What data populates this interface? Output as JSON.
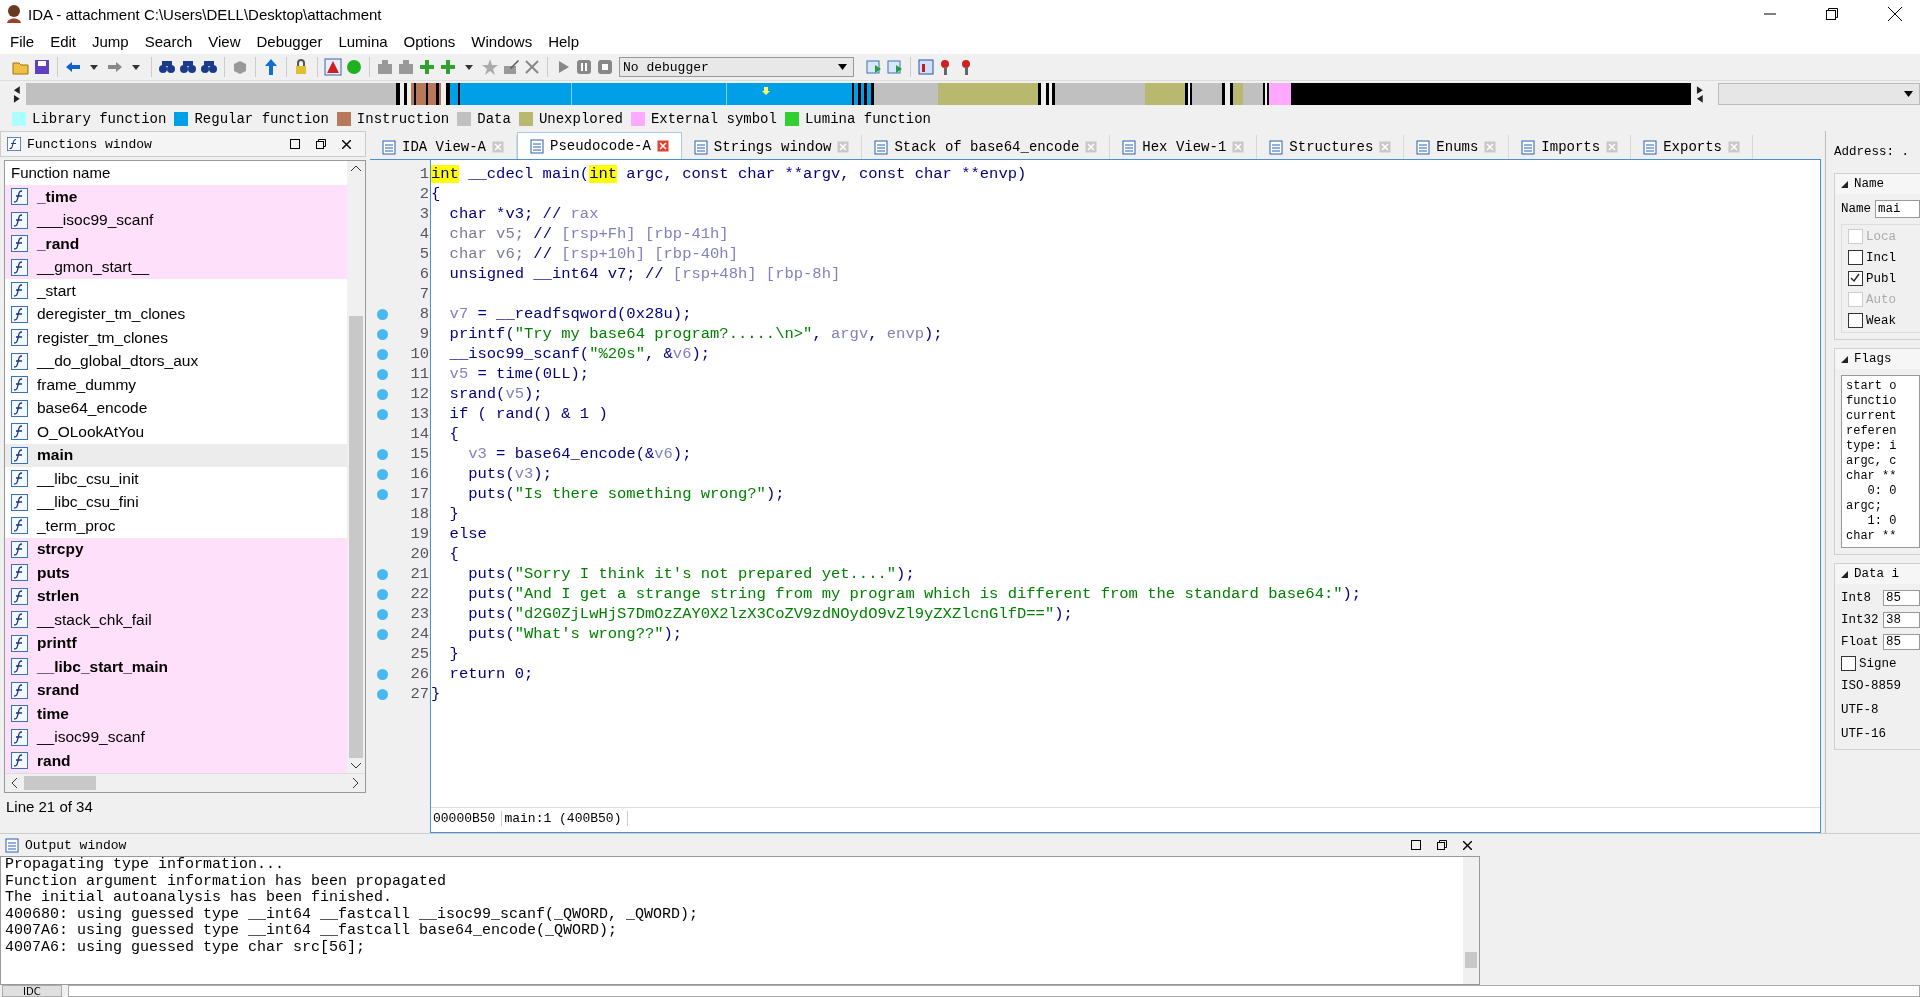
{
  "window": {
    "title": "IDA - attachment C:\\Users\\DELL\\Desktop\\attachment"
  },
  "menu": [
    "File",
    "Edit",
    "Jump",
    "Search",
    "View",
    "Debugger",
    "Lumina",
    "Options",
    "Windows",
    "Help"
  ],
  "toolbar": {
    "debugger_select": "No debugger"
  },
  "legend": [
    {
      "label": "Library function",
      "color": "#aaffff"
    },
    {
      "label": "Regular function",
      "color": "#00a0e8"
    },
    {
      "label": "Instruction",
      "color": "#b8785a"
    },
    {
      "label": "Data",
      "color": "#c0c0c0"
    },
    {
      "label": "Unexplored",
      "color": "#b8b870"
    },
    {
      "label": "External symbol",
      "color": "#ffa8ff"
    },
    {
      "label": "Lumina function",
      "color": "#30d030"
    }
  ],
  "functions_window": {
    "title": "Functions window",
    "column": "Function name",
    "status": "Line 21 of 34",
    "rows": [
      {
        "name": "_time",
        "bold": true,
        "external": true,
        "selected": false
      },
      {
        "name": "___isoc99_scanf",
        "bold": false,
        "external": true,
        "selected": false
      },
      {
        "name": "_rand",
        "bold": true,
        "external": true,
        "selected": false
      },
      {
        "name": "__gmon_start__",
        "bold": false,
        "external": true,
        "selected": false
      },
      {
        "name": "_start",
        "bold": false,
        "external": false,
        "selected": false
      },
      {
        "name": "deregister_tm_clones",
        "bold": false,
        "external": false,
        "selected": false
      },
      {
        "name": "register_tm_clones",
        "bold": false,
        "external": false,
        "selected": false
      },
      {
        "name": "__do_global_dtors_aux",
        "bold": false,
        "external": false,
        "selected": false
      },
      {
        "name": "frame_dummy",
        "bold": false,
        "external": false,
        "selected": false
      },
      {
        "name": "base64_encode",
        "bold": false,
        "external": false,
        "selected": false
      },
      {
        "name": "O_OLookAtYou",
        "bold": false,
        "external": false,
        "selected": false
      },
      {
        "name": "main",
        "bold": true,
        "external": false,
        "selected": true
      },
      {
        "name": "__libc_csu_init",
        "bold": false,
        "external": false,
        "selected": false
      },
      {
        "name": "__libc_csu_fini",
        "bold": false,
        "external": false,
        "selected": false
      },
      {
        "name": "_term_proc",
        "bold": false,
        "external": false,
        "selected": false
      },
      {
        "name": "strcpy",
        "bold": true,
        "external": true,
        "selected": false
      },
      {
        "name": "puts",
        "bold": true,
        "external": true,
        "selected": false
      },
      {
        "name": "strlen",
        "bold": true,
        "external": true,
        "selected": false
      },
      {
        "name": "__stack_chk_fail",
        "bold": false,
        "external": true,
        "selected": false
      },
      {
        "name": "printf",
        "bold": true,
        "external": true,
        "selected": false
      },
      {
        "name": "__libc_start_main",
        "bold": true,
        "external": true,
        "selected": false
      },
      {
        "name": "srand",
        "bold": true,
        "external": true,
        "selected": false
      },
      {
        "name": "time",
        "bold": true,
        "external": true,
        "selected": false
      },
      {
        "name": "__isoc99_scanf",
        "bold": false,
        "external": true,
        "selected": false
      },
      {
        "name": "rand",
        "bold": true,
        "external": true,
        "selected": false
      }
    ]
  },
  "tabs": [
    {
      "label": "IDA View-A",
      "selected": false
    },
    {
      "label": "Pseudocode-A",
      "selected": true
    },
    {
      "label": "Strings window",
      "selected": false
    },
    {
      "label": "Stack of base64_encode",
      "selected": false
    },
    {
      "label": "Hex View-1",
      "selected": false
    },
    {
      "label": "Structures",
      "selected": false
    },
    {
      "label": "Enums",
      "selected": false
    },
    {
      "label": "Imports",
      "selected": false
    },
    {
      "label": "Exports",
      "selected": false
    }
  ],
  "pseudocode": {
    "lines": [
      {
        "num": "1",
        "breakpoint": false,
        "tokens": [
          {
            "text": "int",
            "kind": "hl"
          },
          {
            "text": " __cdecl main(",
            "kind": "plain"
          },
          {
            "text": "int",
            "kind": "hl"
          },
          {
            "text": " argc, const char **argv, const char **envp)",
            "kind": "plain"
          }
        ]
      },
      {
        "num": "2",
        "breakpoint": false,
        "tokens": [
          {
            "text": "{",
            "kind": "plain"
          }
        ]
      },
      {
        "num": "3",
        "breakpoint": false,
        "tokens": [
          {
            "text": "  char *v3; // ",
            "kind": "plain"
          },
          {
            "text": "rax",
            "kind": "var"
          }
        ]
      },
      {
        "num": "4",
        "breakpoint": false,
        "tokens": [
          {
            "text": "  char v5; ",
            "kind": "dim"
          },
          {
            "text": "// ",
            "kind": "plain"
          },
          {
            "text": "[rsp+Fh] [rbp-41h]",
            "kind": "var"
          }
        ]
      },
      {
        "num": "5",
        "breakpoint": false,
        "tokens": [
          {
            "text": "  char v6; ",
            "kind": "dim"
          },
          {
            "text": "// ",
            "kind": "plain"
          },
          {
            "text": "[rsp+10h] [rbp-40h]",
            "kind": "var"
          }
        ]
      },
      {
        "num": "6",
        "breakpoint": false,
        "tokens": [
          {
            "text": "  unsigned __int64 v7; // ",
            "kind": "plain"
          },
          {
            "text": "[rsp+48h] [rbp-8h]",
            "kind": "var"
          }
        ]
      },
      {
        "num": "7",
        "breakpoint": false
      },
      {
        "num": "8",
        "breakpoint": true,
        "tokens": [
          {
            "text": "  v7",
            "kind": "var"
          },
          {
            "text": " = __readfsqword(0x28u);",
            "kind": "plain"
          }
        ]
      },
      {
        "num": "9",
        "breakpoint": true,
        "tokens": [
          {
            "text": "  printf(",
            "kind": "plain"
          },
          {
            "text": "\"Try my base64 program?.....\\n>\"",
            "kind": "str"
          },
          {
            "text": ", ",
            "kind": "plain"
          },
          {
            "text": "argv",
            "kind": "var"
          },
          {
            "text": ", ",
            "kind": "plain"
          },
          {
            "text": "envp",
            "kind": "var"
          },
          {
            "text": ");",
            "kind": "plain"
          }
        ]
      },
      {
        "num": "10",
        "breakpoint": true,
        "tokens": [
          {
            "text": "  __isoc99_scanf(",
            "kind": "plain"
          },
          {
            "text": "\"%20s\"",
            "kind": "str"
          },
          {
            "text": ", &",
            "kind": "plain"
          },
          {
            "text": "v6",
            "kind": "var"
          },
          {
            "text": ");",
            "kind": "plain"
          }
        ]
      },
      {
        "num": "11",
        "breakpoint": true,
        "tokens": [
          {
            "text": "  v5",
            "kind": "var"
          },
          {
            "text": " = time(0LL);",
            "kind": "plain"
          }
        ]
      },
      {
        "num": "12",
        "breakpoint": true,
        "tokens": [
          {
            "text": "  srand(",
            "kind": "plain"
          },
          {
            "text": "v5",
            "kind": "var"
          },
          {
            "text": ");",
            "kind": "plain"
          }
        ]
      },
      {
        "num": "13",
        "breakpoint": true,
        "tokens": [
          {
            "text": "  if ( rand() & 1 )",
            "kind": "plain"
          }
        ]
      },
      {
        "num": "14",
        "breakpoint": false,
        "tokens": [
          {
            "text": "  {",
            "kind": "plain"
          }
        ]
      },
      {
        "num": "15",
        "breakpoint": true,
        "tokens": [
          {
            "text": "    v3",
            "kind": "var"
          },
          {
            "text": " = base64_encode(&",
            "kind": "plain"
          },
          {
            "text": "v6",
            "kind": "var"
          },
          {
            "text": ");",
            "kind": "plain"
          }
        ]
      },
      {
        "num": "16",
        "breakpoint": true,
        "tokens": [
          {
            "text": "    puts(",
            "kind": "plain"
          },
          {
            "text": "v3",
            "kind": "var"
          },
          {
            "text": ");",
            "kind": "plain"
          }
        ]
      },
      {
        "num": "17",
        "breakpoint": true,
        "tokens": [
          {
            "text": "    puts(",
            "kind": "plain"
          },
          {
            "text": "\"Is there something wrong?\"",
            "kind": "str"
          },
          {
            "text": ");",
            "kind": "plain"
          }
        ]
      },
      {
        "num": "18",
        "breakpoint": false,
        "tokens": [
          {
            "text": "  }",
            "kind": "plain"
          }
        ]
      },
      {
        "num": "19",
        "breakpoint": false,
        "tokens": [
          {
            "text": "  else",
            "kind": "plain"
          }
        ]
      },
      {
        "num": "20",
        "breakpoint": false,
        "tokens": [
          {
            "text": "  {",
            "kind": "plain"
          }
        ]
      },
      {
        "num": "21",
        "breakpoint": true,
        "tokens": [
          {
            "text": "    puts(",
            "kind": "plain"
          },
          {
            "text": "\"Sorry I think it's not prepared yet....\"",
            "kind": "str"
          },
          {
            "text": ");",
            "kind": "plain"
          }
        ]
      },
      {
        "num": "22",
        "breakpoint": true,
        "tokens": [
          {
            "text": "    puts(",
            "kind": "plain"
          },
          {
            "text": "\"And I get a strange string from my program which is different from the standard base64:\"",
            "kind": "str"
          },
          {
            "text": ");",
            "kind": "plain"
          }
        ]
      },
      {
        "num": "23",
        "breakpoint": true,
        "tokens": [
          {
            "text": "    puts(",
            "kind": "plain"
          },
          {
            "text": "\"d2G0ZjLwHjS7DmOzZAY0X2lzX3CoZV9zdNOydO9vZl9yZXZlcnGlfD==\"",
            "kind": "str"
          },
          {
            "text": ");",
            "kind": "plain"
          }
        ]
      },
      {
        "num": "24",
        "breakpoint": true,
        "tokens": [
          {
            "text": "    puts(",
            "kind": "plain"
          },
          {
            "text": "\"What's wrong??\"",
            "kind": "str"
          },
          {
            "text": ");",
            "kind": "plain"
          }
        ]
      },
      {
        "num": "25",
        "breakpoint": false,
        "tokens": [
          {
            "text": "  }",
            "kind": "plain"
          }
        ]
      },
      {
        "num": "26",
        "breakpoint": true,
        "tokens": [
          {
            "text": "  return 0;",
            "kind": "plain"
          }
        ]
      },
      {
        "num": "27",
        "breakpoint": true,
        "tokens": [
          {
            "text": "}",
            "kind": "plain"
          }
        ]
      }
    ],
    "status": [
      "00000B50",
      "main:1 (400B50)"
    ]
  },
  "side_panel": {
    "address_label": "Address: .",
    "name_group": "Name",
    "name_label": "Name",
    "name_value": "mai",
    "options": [
      {
        "label": "Loca",
        "checked": false,
        "disabled": true
      },
      {
        "label": "Incl",
        "checked": false,
        "disabled": false
      },
      {
        "label": "Publ",
        "checked": true,
        "disabled": false
      },
      {
        "label": "Auto",
        "checked": false,
        "disabled": true
      },
      {
        "label": "Weak",
        "checked": false,
        "disabled": false
      }
    ],
    "flags_group": "Flags",
    "flags_lines": [
      "start o",
      "functio",
      "current",
      "referen",
      "type: i",
      "argc, c",
      "char **",
      "   0: 0",
      "argc;",
      "   1: 0",
      "char **"
    ],
    "data_group": "Data i",
    "data_fields": [
      {
        "label": "Int8",
        "value": "85"
      },
      {
        "label": "Int32",
        "value": "38"
      },
      {
        "label": "Float",
        "value": "85"
      }
    ],
    "signed": {
      "label": "Signe",
      "checked": false
    },
    "encodings": [
      "ISO-8859",
      "UTF-8",
      "UTF-16"
    ]
  },
  "output_window": {
    "title": "Output window",
    "command_label": "IDC",
    "lines": [
      "Propagating type information...",
      "Function argument information has been propagated",
      "The initial autoanalysis has been finished.",
      "400680: using guessed type __int64 __fastcall __isoc99_scanf(_QWORD, _QWORD);",
      "4007A6: using guessed type __int64 __fastcall base64_encode(_QWORD);",
      "4007A6: using guessed type char src[56];"
    ]
  }
}
